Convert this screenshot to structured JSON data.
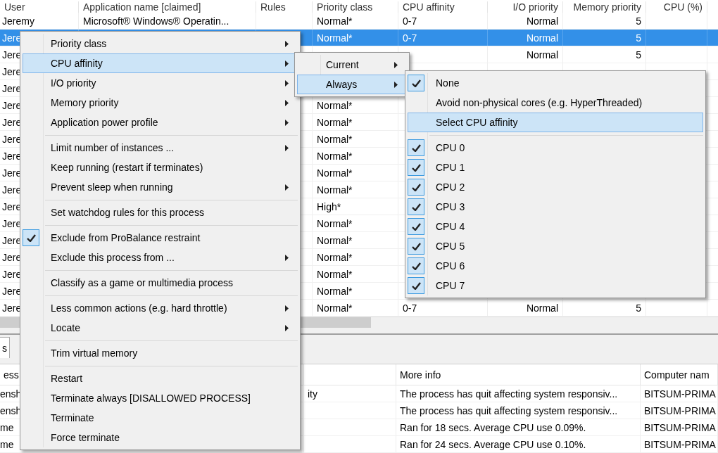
{
  "process_table": {
    "columns": [
      "User",
      "Application name [claimed]",
      "Rules",
      "Priority class",
      "CPU affinity",
      "I/O priority",
      "Memory priority",
      "CPU (%)"
    ],
    "rows": [
      {
        "selected": false,
        "user": "Jeremy",
        "application_name": "Microsoft® Windows® Operatin...",
        "priority_class": "Normal*",
        "cpu_affinity": "0-7",
        "io_priority": "Normal",
        "memory_priority": "5"
      },
      {
        "selected": true,
        "user": "Jere",
        "priority_class": "Normal*",
        "cpu_affinity": "0-7",
        "io_priority": "Normal",
        "memory_priority": "5"
      },
      {
        "selected": false,
        "user": "Jere",
        "io_priority": "Normal",
        "memory_priority": "5"
      },
      {
        "selected": false,
        "user": "Jere"
      },
      {
        "selected": false,
        "user": "Jere"
      },
      {
        "selected": false,
        "user": "Jere",
        "priority_class": "Normal*"
      },
      {
        "selected": false,
        "user": "Jere",
        "priority_class": "Normal*"
      },
      {
        "selected": false,
        "user": "Jere",
        "priority_class": "Normal*"
      },
      {
        "selected": false,
        "user": "Jere",
        "priority_class": "Normal*"
      },
      {
        "selected": false,
        "user": "Jere",
        "priority_class": "Normal*"
      },
      {
        "selected": false,
        "user": "Jere",
        "priority_class": "Normal*"
      },
      {
        "selected": false,
        "user": "Jere",
        "priority_class": "High*"
      },
      {
        "selected": false,
        "user": "Jere",
        "priority_class": "Normal*"
      },
      {
        "selected": false,
        "user": "Jere",
        "priority_class": "Normal*"
      },
      {
        "selected": false,
        "user": "Jere",
        "priority_class": "Normal*"
      },
      {
        "selected": false,
        "user": "Jere",
        "priority_class": "Normal*"
      },
      {
        "selected": false,
        "user": "Jere",
        "priority_class": "Normal*"
      },
      {
        "selected": false,
        "user": "Jere",
        "priority_class": "Normal*",
        "cpu_affinity": "0-7",
        "io_priority": "Normal",
        "memory_priority": "5"
      }
    ]
  },
  "tabs": [
    {
      "label": "s",
      "selected": true
    }
  ],
  "log_table": {
    "columns": [
      "ess",
      "More info",
      "Computer nam"
    ],
    "rows": [
      {
        "column_1": "ensh",
        "column_2": "ity",
        "more_info": "The process has quit affecting system responsiv...",
        "computer_name": "BITSUM-PRIMA"
      },
      {
        "column_1": "ensh",
        "more_info": "The process has quit affecting system responsiv...",
        "computer_name": "BITSUM-PRIMA"
      },
      {
        "column_1": "me",
        "more_info": "Ran for 18 secs. Average CPU use 0.09%.",
        "computer_name": "BITSUM-PRIMA"
      },
      {
        "column_1": "me",
        "more_info": "Ran for 24 secs. Average CPU use 0.10%.",
        "computer_name": "BITSUM-PRIMA"
      }
    ]
  },
  "context_menu": {
    "items": [
      {
        "kind": "item",
        "label": "Priority class",
        "submenu": true,
        "checked": false,
        "selected": false
      },
      {
        "kind": "item",
        "label": "CPU affinity",
        "submenu": true,
        "checked": false,
        "selected": true
      },
      {
        "kind": "item",
        "label": "I/O priority",
        "submenu": true,
        "checked": false,
        "selected": false
      },
      {
        "kind": "item",
        "label": "Memory priority",
        "submenu": true,
        "checked": false,
        "selected": false
      },
      {
        "kind": "item",
        "label": "Application power profile",
        "submenu": true,
        "checked": false,
        "selected": false
      },
      {
        "kind": "separator"
      },
      {
        "kind": "item",
        "label": "Limit number of instances ...",
        "submenu": true,
        "checked": false,
        "selected": false
      },
      {
        "kind": "item",
        "label": "Keep running (restart if terminates)",
        "submenu": false,
        "checked": false,
        "selected": false
      },
      {
        "kind": "item",
        "label": "Prevent sleep when running",
        "submenu": true,
        "checked": false,
        "selected": false
      },
      {
        "kind": "separator"
      },
      {
        "kind": "item",
        "label": "Set watchdog rules for this process",
        "submenu": false,
        "checked": false,
        "selected": false
      },
      {
        "kind": "separator"
      },
      {
        "kind": "item",
        "label": "Exclude from ProBalance restraint",
        "submenu": false,
        "checked": true,
        "selected": false
      },
      {
        "kind": "item",
        "label": "Exclude this process from ...",
        "submenu": true,
        "checked": false,
        "selected": false
      },
      {
        "kind": "separator"
      },
      {
        "kind": "item",
        "label": "Classify as a game or multimedia process",
        "submenu": false,
        "checked": false,
        "selected": false
      },
      {
        "kind": "separator"
      },
      {
        "kind": "item",
        "label": "Less common actions (e.g. hard throttle)",
        "submenu": true,
        "checked": false,
        "selected": false
      },
      {
        "kind": "item",
        "label": "Locate",
        "submenu": true,
        "checked": false,
        "selected": false
      },
      {
        "kind": "separator"
      },
      {
        "kind": "item",
        "label": "Trim virtual memory",
        "submenu": false,
        "checked": false,
        "selected": false
      },
      {
        "kind": "separator"
      },
      {
        "kind": "item",
        "label": "Restart",
        "submenu": false,
        "checked": false,
        "selected": false
      },
      {
        "kind": "item",
        "label": "Terminate always [DISALLOWED PROCESS]",
        "submenu": false,
        "checked": false,
        "selected": false
      },
      {
        "kind": "item",
        "label": "Terminate",
        "submenu": false,
        "checked": false,
        "selected": false
      },
      {
        "kind": "item",
        "label": "Force terminate",
        "submenu": false,
        "checked": false,
        "selected": false
      }
    ]
  },
  "cpu_affinity_submenu": {
    "items": [
      {
        "kind": "item",
        "label": "Current",
        "submenu": true,
        "checked": false,
        "selected": false
      },
      {
        "kind": "item",
        "label": "Always",
        "submenu": true,
        "checked": false,
        "selected": true
      }
    ]
  },
  "always_submenu": {
    "items": [
      {
        "kind": "item",
        "label": "None",
        "submenu": false,
        "checked": true,
        "selected": false
      },
      {
        "kind": "item",
        "label": "Avoid non-physical cores (e.g. HyperThreaded)",
        "submenu": false,
        "checked": false,
        "selected": false
      },
      {
        "kind": "item",
        "label": "Select CPU affinity",
        "submenu": false,
        "checked": false,
        "selected": true
      },
      {
        "kind": "separator"
      },
      {
        "kind": "item",
        "label": "CPU 0",
        "submenu": false,
        "checked": true,
        "selected": false
      },
      {
        "kind": "item",
        "label": "CPU 1",
        "submenu": false,
        "checked": true,
        "selected": false
      },
      {
        "kind": "item",
        "label": "CPU 2",
        "submenu": false,
        "checked": true,
        "selected": false
      },
      {
        "kind": "item",
        "label": "CPU 3",
        "submenu": false,
        "checked": true,
        "selected": false
      },
      {
        "kind": "item",
        "label": "CPU 4",
        "submenu": false,
        "checked": true,
        "selected": false
      },
      {
        "kind": "item",
        "label": "CPU 5",
        "submenu": false,
        "checked": true,
        "selected": false
      },
      {
        "kind": "item",
        "label": "CPU 6",
        "submenu": false,
        "checked": true,
        "selected": false
      },
      {
        "kind": "item",
        "label": "CPU 7",
        "submenu": false,
        "checked": true,
        "selected": false
      }
    ]
  }
}
